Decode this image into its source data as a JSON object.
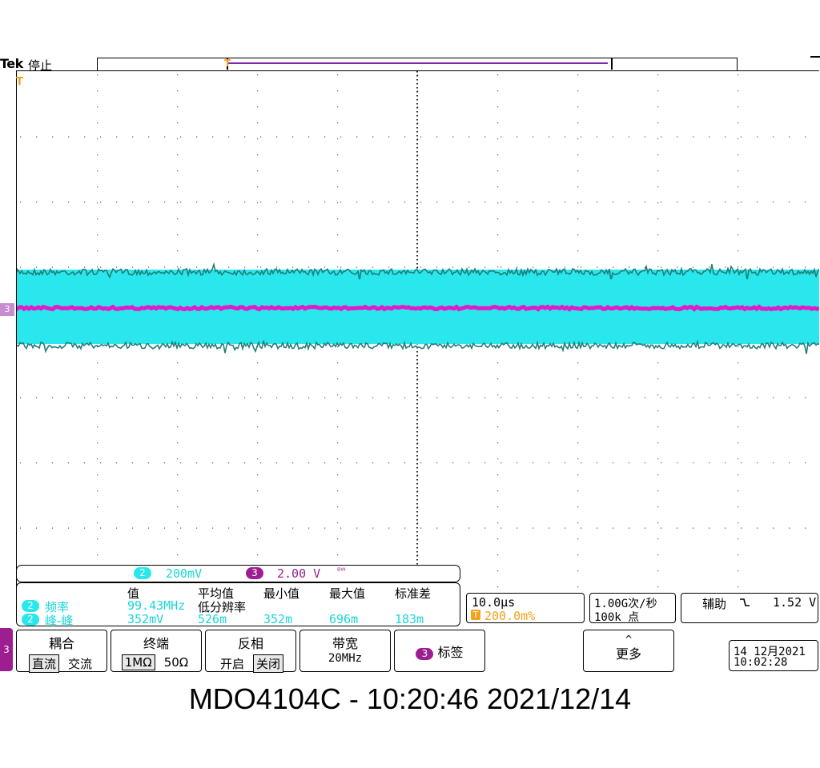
{
  "topbar": {
    "brand": "Tek",
    "state": "停止"
  },
  "trigger_marker": "T",
  "channel_marker": "3",
  "channel_bar": {
    "ch2": {
      "chip": "2",
      "scale": "200mV"
    },
    "ch3": {
      "chip": "3",
      "scale": "2.00 V",
      "bw_icon": "ᴮᵂ"
    }
  },
  "measurements": {
    "headers": {
      "value": "值",
      "mean": "平均值",
      "min": "最小值",
      "max": "最大值",
      "std": "标准差"
    },
    "rows": [
      {
        "chip": "2",
        "name": "频率",
        "value": "99.43MHz",
        "note": "低分辨率",
        "mean": "",
        "min": "",
        "max": "",
        "std": ""
      },
      {
        "chip": "2",
        "name": "峰-峰",
        "value": "352mV",
        "note": "",
        "mean": "526m",
        "min": "352m",
        "max": "696m",
        "std": "183m"
      }
    ]
  },
  "timebase": {
    "scale": "10.0µs",
    "trig_icon": "T",
    "position": "200.0m%"
  },
  "acquisition": {
    "rate": "1.00G次/秒",
    "points": "100k 点"
  },
  "trigger": {
    "source": "辅助",
    "slope_icon": "falling-edge-icon",
    "level": "1.52 V"
  },
  "menu": {
    "side_chip": "3",
    "coupling": {
      "title": "耦合",
      "options": [
        "直流",
        "交流"
      ],
      "selected": "直流"
    },
    "termination": {
      "title": "终端",
      "options": [
        "1MΩ",
        "50Ω"
      ],
      "selected": "1MΩ"
    },
    "invert": {
      "title": "反相",
      "options": [
        "开启",
        "关闭"
      ],
      "selected": "关闭"
    },
    "bandwidth": {
      "title": "带宽",
      "value": "20MHz"
    },
    "label": {
      "chip": "3",
      "title": "标签"
    },
    "more": {
      "arrow": "^",
      "title": "更多"
    }
  },
  "datetime": {
    "date": "14 12月2021",
    "time": "10:02:28"
  },
  "caption": "MDO4104C - 10:20:46   2021/12/14",
  "colors": {
    "ch2": "#29e7ec",
    "ch2_edge": "#1f7f7a",
    "ch3": "#e21ac8",
    "trigger": "#f3a21b"
  }
}
